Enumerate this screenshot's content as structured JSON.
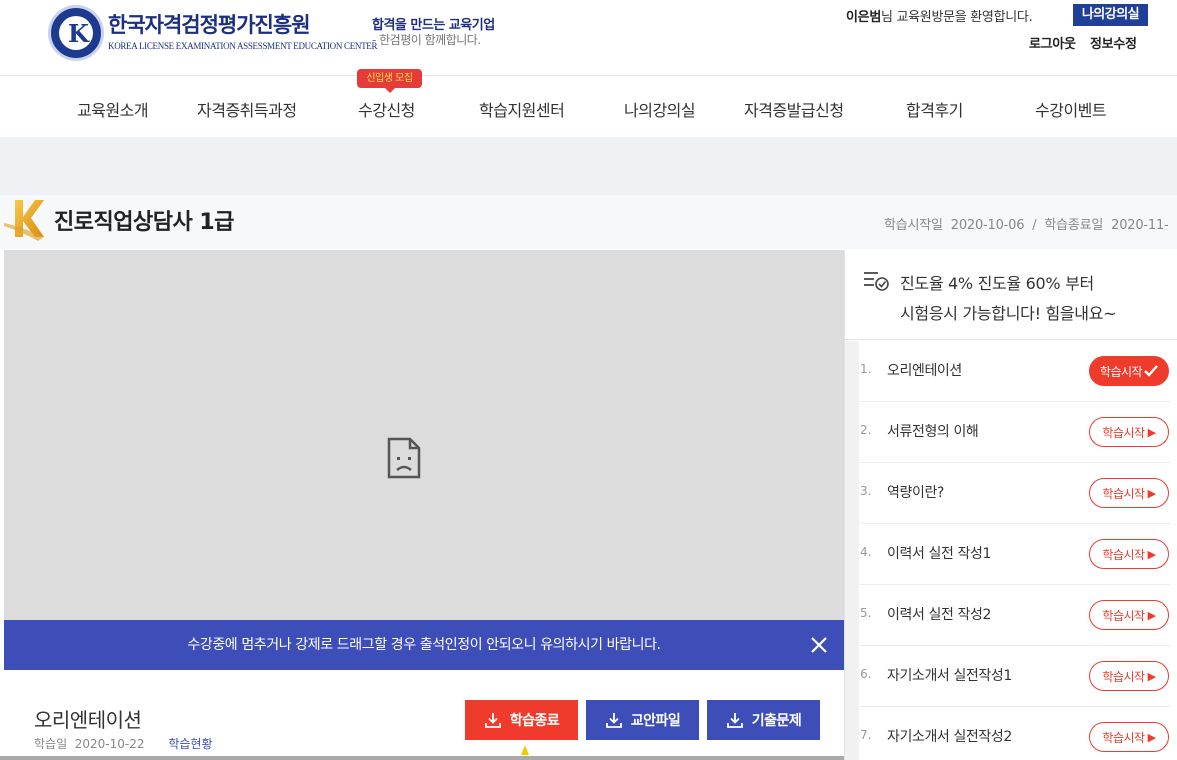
{
  "header": {
    "brand_name": "한국자격검정평가진흥원",
    "brand_en": "KOREA LICENSE EXAMINATION ASSESSMENT  EDUCATION CENTER",
    "slogan1": "합격을 만드는 교육기업",
    "slogan2": "- 한검평이 함께합니다.",
    "user_name": "이은범",
    "welcome_suffix": "님  교육원방문을 환영합니다.",
    "myroom_label": "나의강의실",
    "logout_label": "로그아웃",
    "editinfo_label": "정보수정"
  },
  "nav": {
    "items": [
      "교육원소개",
      "자격증취득과정",
      "수강신청",
      "학습지원센터",
      "나의강의실",
      "자격증발급신청",
      "합격후기",
      "수강이벤트"
    ],
    "badge": "신입생 모집"
  },
  "course": {
    "title": "진로직업상담사 1급",
    "start_label": "학습시작일",
    "start_date": "2020-10-06",
    "separator": "/",
    "end_label": "학습종료일",
    "end_date": "2020-11-"
  },
  "player": {
    "notice": "수강중에 멈추거나 강제로 드래그할 경우 출석인정이 안되오니 유의하시기 바랍니다.",
    "lesson_name": "오리엔테이션",
    "date_label": "학습일",
    "date": "2020-10-22",
    "status_link": "학습현황",
    "buttons": {
      "end": "학습종료",
      "file": "교안파일",
      "exam": "기출문제"
    }
  },
  "sidebar": {
    "progress_line1": "진도율 4% 진도율 60% 부터",
    "progress_line2": "시험응시 가능합니다! 힘을내요~",
    "lessons": [
      {
        "num": "1.",
        "title": "오리엔테이션",
        "button": "학습시작",
        "active": true
      },
      {
        "num": "2.",
        "title": "서류전형의 이해",
        "button": "학습시작",
        "active": false
      },
      {
        "num": "3.",
        "title": "역량이란?",
        "button": "학습시작",
        "active": false
      },
      {
        "num": "4.",
        "title": "이력서 실전 작성1",
        "button": "학습시작",
        "active": false
      },
      {
        "num": "5.",
        "title": "이력서 실전 작성2",
        "button": "학습시작",
        "active": false
      },
      {
        "num": "6.",
        "title": "자기소개서 실전작성1",
        "button": "학습시작",
        "active": false
      },
      {
        "num": "7.",
        "title": "자기소개서 실전작성2",
        "button": "학습시작",
        "active": false
      }
    ]
  },
  "colors": {
    "brand_navy": "#1c2f80",
    "accent_red": "#ef3b2c",
    "accent_blue": "#3e4eb8"
  }
}
